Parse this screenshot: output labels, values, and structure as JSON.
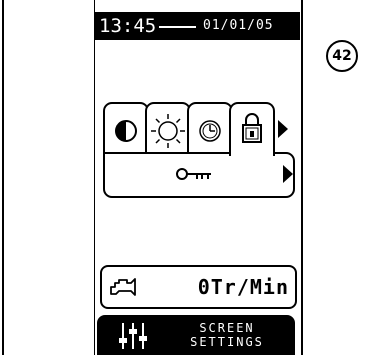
{
  "status": {
    "time": "13:45",
    "date": "01/01/05"
  },
  "badge": "42",
  "tabs": [
    {
      "icon": "contrast-icon"
    },
    {
      "icon": "brightness-icon"
    },
    {
      "icon": "clock-icon"
    },
    {
      "icon": "lock-icon",
      "active": true
    }
  ],
  "panel": {
    "icon": "key-icon"
  },
  "engine": {
    "icon": "engine-icon",
    "value": "0Tr/Min"
  },
  "bottom": {
    "icon": "sliders-icon",
    "line1": "SCREEN",
    "line2": "SETTINGS"
  }
}
